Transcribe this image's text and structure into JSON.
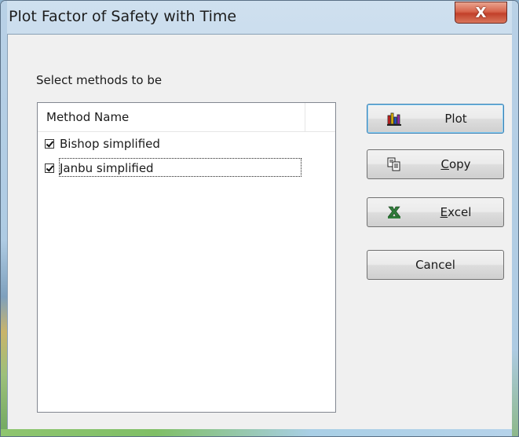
{
  "window": {
    "title": "Plot Factor of Safety with Time",
    "close_glyph": "X"
  },
  "panel": {
    "select_label": "Select methods to be"
  },
  "list": {
    "header": "Method Name",
    "items": [
      {
        "label": "Bishop simplified",
        "checked": true
      },
      {
        "label": "Janbu simplified",
        "checked": true
      }
    ]
  },
  "buttons": {
    "plot": {
      "label": "Plot",
      "icon": "bar-chart-icon"
    },
    "copy": {
      "label_first": "C",
      "label_rest": "opy",
      "icon": "copy-icon"
    },
    "excel": {
      "label_first": "E",
      "label_rest": "xcel",
      "icon": "excel-icon"
    },
    "cancel": {
      "label": "Cancel"
    }
  },
  "colors": {
    "close_button": "#c2402a",
    "dialog_background": "#f0f0f0",
    "default_button_border": "#3c7fb1"
  }
}
